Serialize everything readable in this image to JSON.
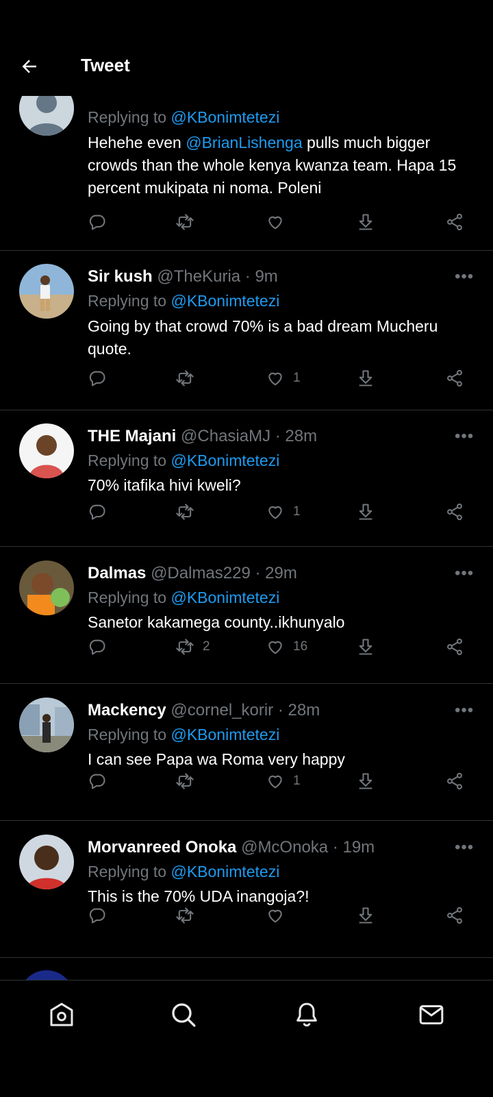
{
  "header": {
    "title": "Tweet"
  },
  "tweets": [
    {
      "name": "",
      "handle": "",
      "time": "",
      "replying_prefix": "Replying to ",
      "replying_to": "@KBonimtetezi",
      "text_before": "Hehehe even ",
      "text_mention": "@BrianLishenga",
      "text_after": " pulls much bigger crowds than the whole kenya kwanza team. Hapa 15 percent mukipata ni noma. Poleni",
      "retweets": "",
      "likes": ""
    },
    {
      "name": "Sir kush",
      "handle": "@TheKuria · 9m",
      "replying_prefix": "Replying to ",
      "replying_to": "@KBonimtetezi",
      "text": "Going  by  that  crowd  70% is a bad  dream Mucheru  quote.",
      "retweets": "",
      "likes": "1"
    },
    {
      "name": "THE Majani",
      "handle": "@ChasiaMJ · 28m",
      "replying_prefix": "Replying to ",
      "replying_to": "@KBonimtetezi",
      "text": "70% itafika hivi kweli?",
      "retweets": "",
      "likes": "1"
    },
    {
      "name": "Dalmas",
      "handle": "@Dalmas229 · 29m",
      "replying_prefix": "Replying to ",
      "replying_to": "@KBonimtetezi",
      "text": "Sanetor kakamega county..ikhunyalo",
      "retweets": "2",
      "likes": "16"
    },
    {
      "name": "Mackency",
      "handle": "@cornel_korir · 28m",
      "replying_prefix": "Replying to ",
      "replying_to": "@KBonimtetezi",
      "text": "I can see Papa wa Roma very happy",
      "retweets": "",
      "likes": "1"
    },
    {
      "name": "Morvanreed Onoka",
      "handle": "@McOnoka · 19m",
      "replying_prefix": "Replying to ",
      "replying_to": "@KBonimtetezi",
      "text": "This is the 70% UDA inangoja?!",
      "retweets": "",
      "likes": ""
    }
  ],
  "more_glyph": "•••",
  "icons": {
    "back": "arrow-left-icon",
    "reply": "reply-icon",
    "retweet": "retweet-icon",
    "like": "heart-icon",
    "download": "download-icon",
    "share": "share-icon",
    "home": "home-icon",
    "search": "search-icon",
    "notifications": "bell-icon",
    "messages": "mail-icon"
  },
  "colors": {
    "background": "#000000",
    "link": "#1d9bf0",
    "secondary": "#71767b",
    "divider": "#2f3336"
  }
}
